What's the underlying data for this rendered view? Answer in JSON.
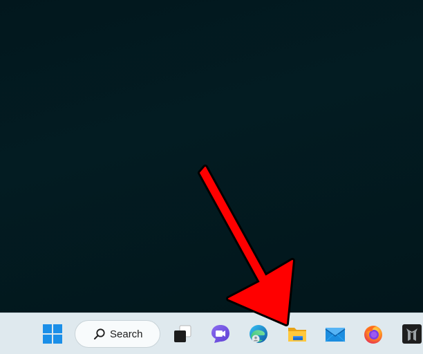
{
  "taskbar": {
    "search": {
      "label": "Search",
      "icon": "search-icon"
    },
    "items": [
      {
        "name": "start-button",
        "icon": "windows-logo-icon"
      },
      {
        "name": "task-view-button",
        "icon": "task-view-icon"
      },
      {
        "name": "teams-chat-button",
        "icon": "teams-chat-icon"
      },
      {
        "name": "edge-button",
        "icon": "edge-icon"
      },
      {
        "name": "file-explorer-button",
        "icon": "folder-icon"
      },
      {
        "name": "mail-button",
        "icon": "mail-icon"
      },
      {
        "name": "firefox-button",
        "icon": "firefox-icon"
      },
      {
        "name": "predator-sense-button",
        "icon": "predator-icon"
      }
    ]
  },
  "colors": {
    "desktop": "#031c22",
    "taskbar": "#dfe9ee",
    "arrow": "#ff0000",
    "accent": "#0078d4"
  }
}
